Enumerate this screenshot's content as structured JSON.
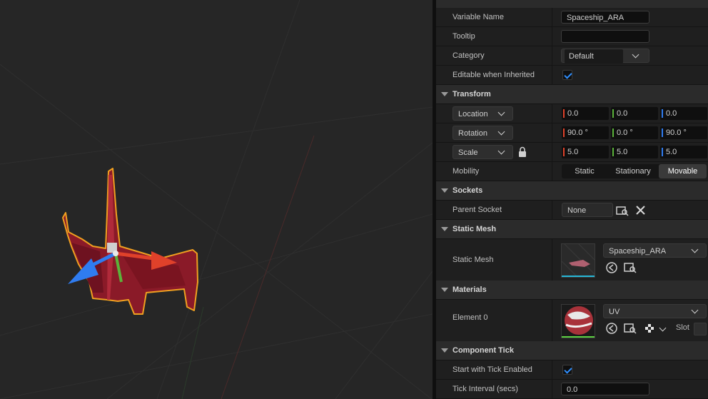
{
  "viewport": {
    "label": "Level viewport"
  },
  "details": {
    "variable": {
      "name_label": "Variable Name",
      "name_value": "Spaceship_ARA",
      "tooltip_label": "Tooltip",
      "tooltip_value": "",
      "category_label": "Category",
      "category_value": "Default",
      "editable_label": "Editable when Inherited",
      "editable_checked": true
    },
    "transform": {
      "title": "Transform",
      "location": {
        "mode": "Location",
        "x": "0.0",
        "y": "0.0",
        "z": "0.0"
      },
      "rotation": {
        "mode": "Rotation",
        "x": "90.0 °",
        "y": "0.0 °",
        "z": "90.0 °"
      },
      "scale": {
        "mode": "Scale",
        "x": "5.0",
        "y": "5.0",
        "z": "5.0"
      },
      "mobility_label": "Mobility",
      "mobility_options": [
        "Static",
        "Stationary",
        "Movable"
      ],
      "mobility_selected": "Movable"
    },
    "sockets": {
      "title": "Sockets",
      "parent_label": "Parent Socket",
      "parent_value": "None"
    },
    "static_mesh": {
      "title": "Static Mesh",
      "label": "Static Mesh",
      "value": "Spaceship_ARA"
    },
    "materials": {
      "title": "Materials",
      "element_label": "Element 0",
      "value": "UV",
      "slot_label": "Slot"
    },
    "component_tick": {
      "title": "Component Tick",
      "start_label": "Start with Tick Enabled",
      "start_checked": true,
      "interval_label": "Tick Interval (secs)",
      "interval_value": "0.0"
    }
  },
  "colors": {
    "x_axis": "#e0412a",
    "y_axis": "#5bb33a",
    "z_axis": "#2f7cf0",
    "selection": "#f0a020",
    "accent": "#2f8fff"
  }
}
